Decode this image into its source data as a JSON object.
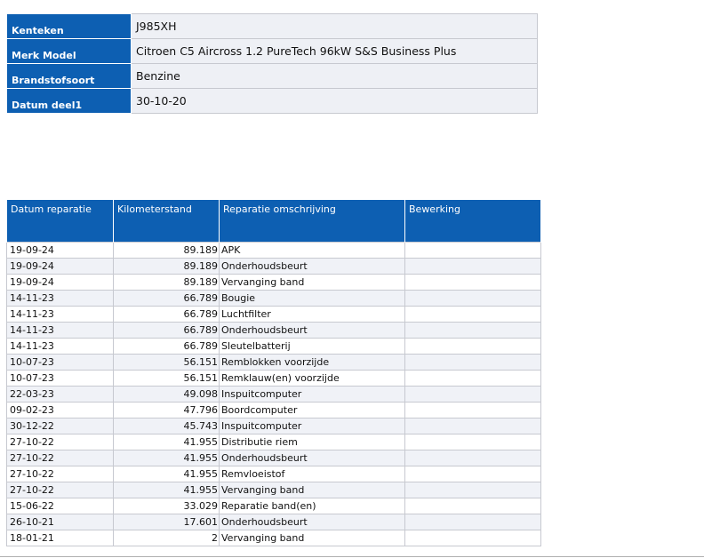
{
  "vehicle": [
    {
      "label": "Kenteken",
      "value": "J985XH"
    },
    {
      "label": "Merk Model",
      "value": "Citroen C5 Aircross 1.2 PureTech 96kW S&S Business Plus"
    },
    {
      "label": "Brandstofsoort",
      "value": "Benzine"
    },
    {
      "label": "Datum deel1",
      "value": "30-10-20"
    }
  ],
  "repairs": {
    "headers": [
      "Datum reparatie",
      "Kilometerstand",
      "Reparatie omschrijving",
      "Bewerking"
    ],
    "rows": [
      {
        "date": "19-09-24",
        "km": "89.189",
        "desc": "APK",
        "action": ""
      },
      {
        "date": "19-09-24",
        "km": "89.189",
        "desc": "Onderhoudsbeurt",
        "action": ""
      },
      {
        "date": "19-09-24",
        "km": "89.189",
        "desc": "Vervanging band",
        "action": ""
      },
      {
        "date": "14-11-23",
        "km": "66.789",
        "desc": "Bougie",
        "action": ""
      },
      {
        "date": "14-11-23",
        "km": "66.789",
        "desc": "Luchtfilter",
        "action": ""
      },
      {
        "date": "14-11-23",
        "km": "66.789",
        "desc": "Onderhoudsbeurt",
        "action": ""
      },
      {
        "date": "14-11-23",
        "km": "66.789",
        "desc": "Sleutelbatterij",
        "action": ""
      },
      {
        "date": "10-07-23",
        "km": "56.151",
        "desc": "Remblokken voorzijde",
        "action": ""
      },
      {
        "date": "10-07-23",
        "km": "56.151",
        "desc": "Remklauw(en) voorzijde",
        "action": ""
      },
      {
        "date": "22-03-23",
        "km": "49.098",
        "desc": "Inspuitcomputer",
        "action": ""
      },
      {
        "date": "09-02-23",
        "km": "47.796",
        "desc": "Boordcomputer",
        "action": ""
      },
      {
        "date": "30-12-22",
        "km": "45.743",
        "desc": "Inspuitcomputer",
        "action": ""
      },
      {
        "date": "27-10-22",
        "km": "41.955",
        "desc": "Distributie riem",
        "action": ""
      },
      {
        "date": "27-10-22",
        "km": "41.955",
        "desc": "Onderhoudsbeurt",
        "action": ""
      },
      {
        "date": "27-10-22",
        "km": "41.955",
        "desc": "Remvloeistof",
        "action": ""
      },
      {
        "date": "27-10-22",
        "km": "41.955",
        "desc": "Vervanging band",
        "action": ""
      },
      {
        "date": "15-06-22",
        "km": "33.029",
        "desc": "Reparatie band(en)",
        "action": ""
      },
      {
        "date": "26-10-21",
        "km": "17.601",
        "desc": "Onderhoudsbeurt",
        "action": ""
      },
      {
        "date": "18-01-21",
        "km": "2",
        "desc": "Vervanging band",
        "action": ""
      }
    ]
  },
  "colors": {
    "header_blue": "#0d5fb2",
    "row_alt": "#f0f2f7",
    "value_bg": "#eef0f5"
  }
}
